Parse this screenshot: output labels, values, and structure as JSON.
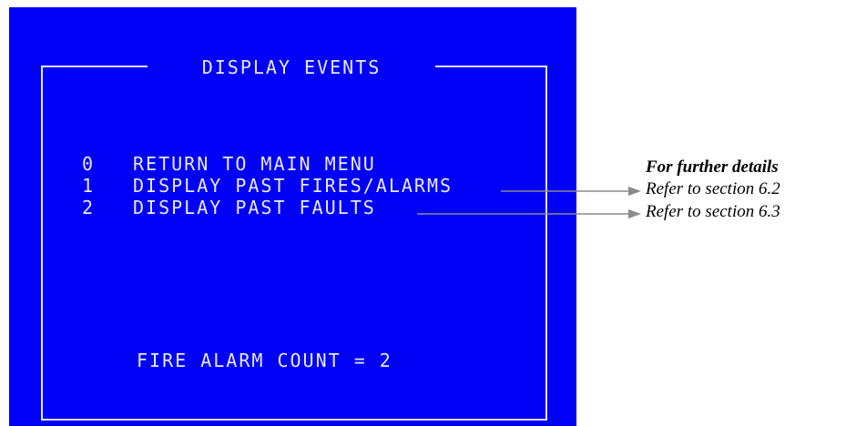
{
  "screen": {
    "title": "DISPLAY EVENTS",
    "menu": [
      {
        "key": "0",
        "label": "RETURN TO MAIN MENU"
      },
      {
        "key": "1",
        "label": "DISPLAY PAST FIRES/ALARMS"
      },
      {
        "key": "2",
        "label": "DISPLAY PAST FAULTS"
      }
    ],
    "status": "FIRE ALARM COUNT = 2",
    "colors": {
      "background": "#0000f6",
      "text": "#e8e8ff"
    }
  },
  "notes": {
    "heading": "For further details",
    "items": [
      "Refer to section 6.2",
      "Refer to section 6.3"
    ]
  }
}
